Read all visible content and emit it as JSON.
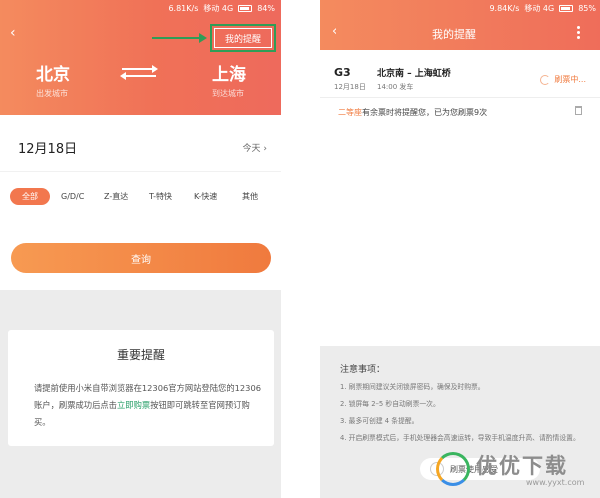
{
  "left": {
    "status": {
      "speed": "6.81K/s",
      "carrier": "移动 4G",
      "battery": "84%"
    },
    "back_icon": "back-chevron-icon",
    "reminder_button": "我的提醒",
    "from_city": "北京",
    "from_label": "出发城市",
    "to_city": "上海",
    "to_label": "到达城市",
    "date": "12月18日",
    "today": "今天",
    "filters": [
      "全部",
      "G/D/C",
      "Z-直达",
      "T-特快",
      "K-快速",
      "其他"
    ],
    "query_button": "查询",
    "notice": {
      "title": "重要提醒",
      "body_pre": "请提前使用小米自带浏览器在12306官方网站登陆您的12306账户，刷票成功后点击",
      "link": "立即购票",
      "body_post": "按钮即可跳转至官网预订购买。"
    }
  },
  "right": {
    "status": {
      "speed": "9.84K/s",
      "carrier": "移动 4G",
      "battery": "85%"
    },
    "title": "我的提醒",
    "ticket": {
      "train_no": "G3",
      "date": "12月18日",
      "route": "北京南 – 上海虹桥",
      "depart": "14:00 发车",
      "state": "刷票中..."
    },
    "note": {
      "seat": "二等座",
      "text": "有余票时将提醒您，已为您刷票9次"
    },
    "hints": {
      "title": "注意事项：",
      "items": [
        "1. 刷票期间建议关闭锁屏密码，确保及时购票。",
        "2. 锁屏每 2–5 秒自动刷票一次。",
        "3. 最多可创建 4 条提醒。",
        "4. 开启刷票模式后，手机处理器会高速运转，导致手机温度升高、请酌情设置。"
      ],
      "toggle_label": "刷票使用感受"
    }
  },
  "watermark": {
    "name": "优优下载",
    "url": "www.yyxt.com"
  },
  "colors": {
    "accent": "#f07157",
    "green": "#2f9d57",
    "link": "#2aa06a"
  }
}
